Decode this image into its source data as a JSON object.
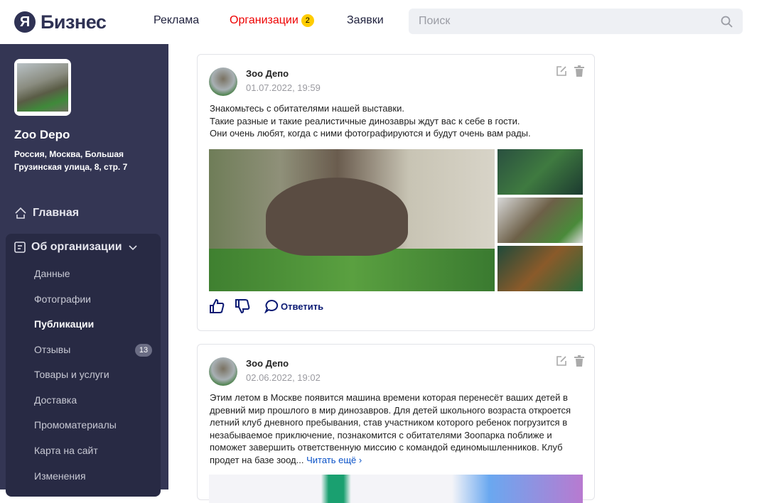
{
  "header": {
    "logo_mark": "Я",
    "logo_text": "Бизнес",
    "nav": [
      {
        "label": "Реклама"
      },
      {
        "label": "Организации",
        "badge": "2"
      },
      {
        "label": "Заявки"
      }
    ],
    "search_placeholder": "Поиск"
  },
  "sidebar": {
    "org_name": "Zoo Depo",
    "address": "Россия, Москва, Большая Грузинская улица, 8, стр. 7",
    "home": "Главная",
    "section": "Об организации",
    "items": [
      {
        "label": "Данные"
      },
      {
        "label": "Фотографии"
      },
      {
        "label": "Публикации"
      },
      {
        "label": "Отзывы",
        "count": "13"
      },
      {
        "label": "Товары и услуги"
      },
      {
        "label": "Доставка"
      },
      {
        "label": "Промоматериалы"
      },
      {
        "label": "Карта на сайт"
      },
      {
        "label": "Изменения"
      }
    ]
  },
  "posts": [
    {
      "author": "Зоо Депо",
      "date": "01.07.2022, 19:59",
      "text": "Знакомьтесь с обитателями нашей выставки.\nТакие разные и такие реалистичные динозавры ждут вас к себе в гости.\nОни очень любят, когда с ними фотографируются и будут очень вам рады.",
      "reply": "Ответить"
    },
    {
      "author": "Зоо Депо",
      "date": "02.06.2022, 19:02",
      "text": "Этим летом в Москве появится машина времени которая перенесёт ваших детей в древний мир прошлого в мир динозавров. Для детей школьного возраста откроется летний клуб дневного пребывания, став участником которого ребенок погрузится в незабываемое приключение, познакомится с обитателями Зоопарка поближе и поможет завершить ответственную миссию с командой единомышленников. Клуб продет на базе зоод...",
      "read_more": "Читать ещё ›"
    }
  ]
}
